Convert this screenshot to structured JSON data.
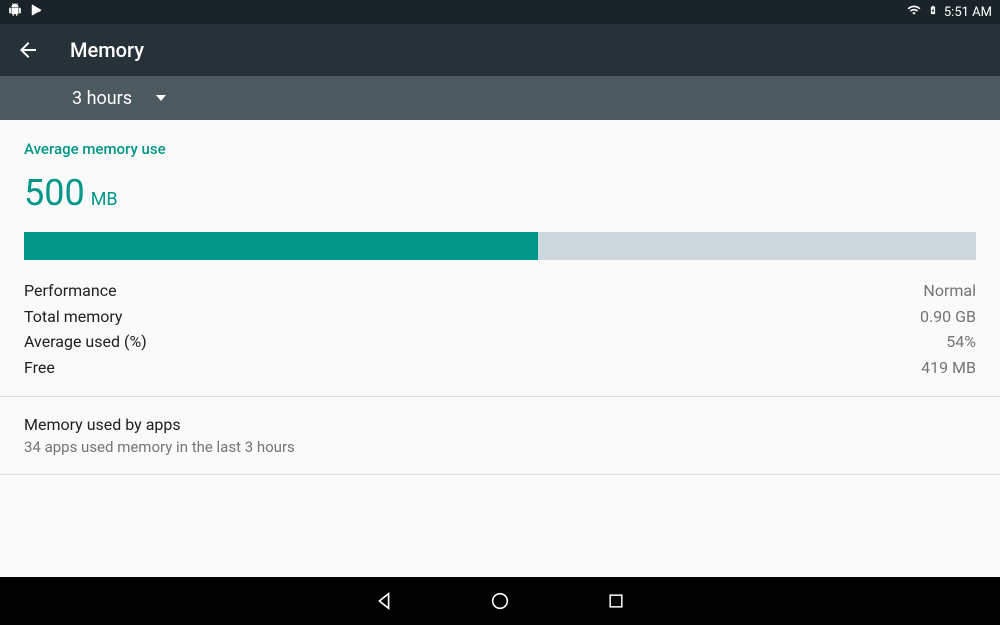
{
  "statusbar": {
    "time": "5:51 AM"
  },
  "appbar": {
    "title": "Memory"
  },
  "dropdown": {
    "selected": "3 hours"
  },
  "average": {
    "label": "Average memory use",
    "value": "500",
    "unit": "MB",
    "percent": 54
  },
  "stats": {
    "performance_label": "Performance",
    "performance_value": "Normal",
    "total_label": "Total memory",
    "total_value": "0.90 GB",
    "avgused_label": "Average used (%)",
    "avgused_value": "54%",
    "free_label": "Free",
    "free_value": "419 MB"
  },
  "apps": {
    "title": "Memory used by apps",
    "subtitle": "34 apps used memory in the last 3 hours"
  }
}
